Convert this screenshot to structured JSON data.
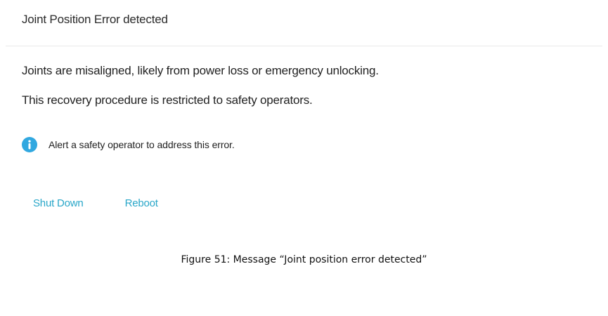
{
  "dialog": {
    "title": "Joint Position Error detected",
    "messages": [
      "Joints are misaligned, likely from power loss or emergency unlocking.",
      "This recovery procedure is restricted to safety operators."
    ],
    "info": {
      "icon": "info-icon",
      "text": "Alert a safety operator to address this error."
    },
    "actions": [
      {
        "label": "Shut Down"
      },
      {
        "label": "Reboot"
      }
    ]
  },
  "caption": "Figure 51: Message “Joint position error detected”",
  "colors": {
    "accent": "#2aa7c9",
    "info_icon": "#31a8e0",
    "divider": "#e8e8e8"
  }
}
